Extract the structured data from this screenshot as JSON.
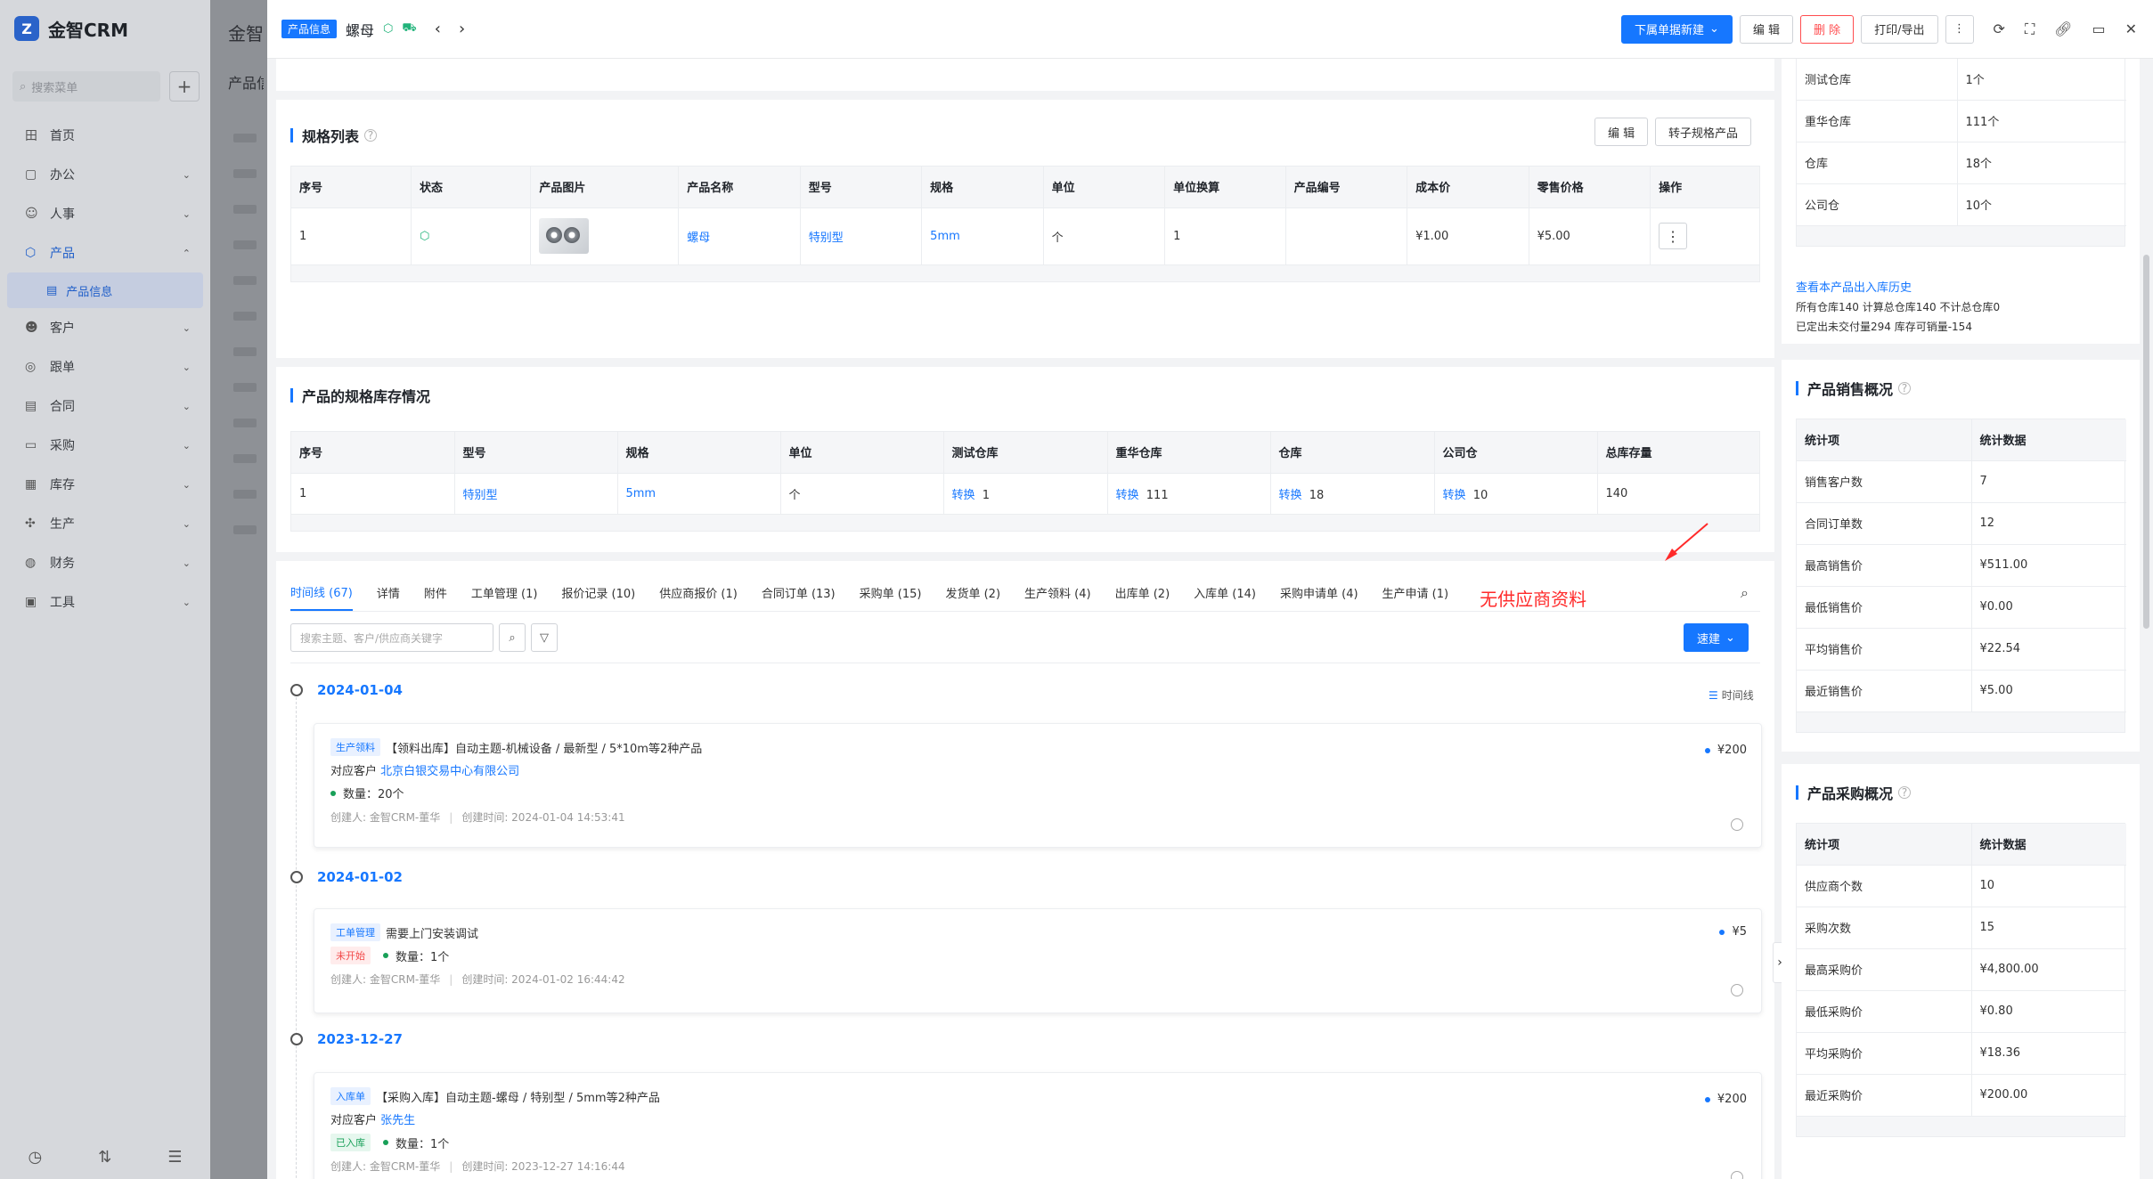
{
  "sidebar": {
    "logo_mark": "Z",
    "brand": "金智CRM",
    "search_placeholder": "搜索菜单",
    "items": [
      {
        "icon": "田",
        "label": "首页"
      },
      {
        "icon": "▢",
        "label": "办公"
      },
      {
        "icon": "☺",
        "label": "人事"
      },
      {
        "icon": "⬡",
        "label": "产品"
      },
      {
        "icon": "☻",
        "label": "客户"
      },
      {
        "icon": "◎",
        "label": "跟单"
      },
      {
        "icon": "▤",
        "label": "合同"
      },
      {
        "icon": "▭",
        "label": "采购"
      },
      {
        "icon": "▦",
        "label": "库存"
      },
      {
        "icon": "✣",
        "label": "生产"
      },
      {
        "icon": "◍",
        "label": "财务"
      },
      {
        "icon": "▣",
        "label": "工具"
      }
    ],
    "sub_item": "产品信息"
  },
  "background_page": {
    "title": "金智银",
    "subtitle": "产品信"
  },
  "header": {
    "tag": "产品信息",
    "title": "螺母",
    "primary_button": "下属单据新建",
    "edit_button": "编 辑",
    "delete_button": "删 除",
    "print_button": "打印/导出"
  },
  "spec_list": {
    "title": "规格列表",
    "edit_button": "编 辑",
    "convert_button": "转子规格产品",
    "columns": [
      "序号",
      "状态",
      "产品图片",
      "产品名称",
      "型号",
      "规格",
      "单位",
      "单位换算",
      "产品编号",
      "成本价",
      "零售价格",
      "操作"
    ],
    "row": {
      "no": "1",
      "name": "螺母",
      "model": "特别型",
      "spec": "5mm",
      "unit": "个",
      "conv": "1",
      "code": "",
      "cost": "¥1.00",
      "retail": "¥5.00"
    }
  },
  "spec_stock": {
    "title": "产品的规格库存情况",
    "columns": [
      "序号",
      "型号",
      "规格",
      "单位",
      "测试仓库",
      "重华仓库",
      "仓库",
      "公司仓",
      "总库存量"
    ],
    "link": "转换",
    "row": {
      "no": "1",
      "model": "特别型",
      "spec": "5mm",
      "unit": "个",
      "w1": "1",
      "w2": "111",
      "w3": "18",
      "w4": "10",
      "total": "140"
    }
  },
  "tabs": {
    "items": [
      "时间线 (67)",
      "详情",
      "附件",
      "工单管理 (1)",
      "报价记录 (10)",
      "供应商报价 (1)",
      "合同订单 (13)",
      "采购单 (15)",
      "发货单 (2)",
      "生产领料 (4)",
      "出库单 (2)",
      "入库单 (14)",
      "采购申请单 (4)",
      "生产申请 (1)"
    ],
    "annotation": "无供应商资料"
  },
  "timeline": {
    "search_placeholder": "搜索主题、客户/供应商关键字",
    "quick_button": "速建",
    "view_label": "时间线",
    "groups": [
      {
        "date": "2024-01-04",
        "tag": "生产领料",
        "title": "【领料出库】自动主题-机械设备 / 最新型 / 5*10m等2种产品",
        "customer_label": "对应客户",
        "customer": "北京白银交易中心有限公司",
        "status": "",
        "qty": "数量：20个",
        "amount": "¥200",
        "creator": "创建人: 金智CRM-董华",
        "created": "创建时间: 2024-01-04 14:53:41"
      },
      {
        "date": "2024-01-02",
        "tag": "工单管理",
        "title": "需要上门安装调试",
        "customer_label": "",
        "customer": "",
        "status": "未开始",
        "qty": "数量：1个",
        "amount": "¥5",
        "creator": "创建人: 金智CRM-董华",
        "created": "创建时间: 2024-01-02 16:44:42"
      },
      {
        "date": "2023-12-27",
        "tag": "入库单",
        "title": "【采购入库】自动主题-螺母 / 特别型 / 5mm等2种产品",
        "customer_label": "对应客户",
        "customer": "张先生",
        "status": "已入库",
        "qty": "数量：1个",
        "amount": "¥200",
        "creator": "创建人: 金智CRM-董华",
        "created": "创建时间: 2023-12-27 14:16:44"
      }
    ]
  },
  "warehouse_panel": {
    "rows": [
      [
        "测试仓库",
        "1个"
      ],
      [
        "重华仓库",
        "111个"
      ],
      [
        "仓库",
        "18个"
      ],
      [
        "公司仓",
        "10个"
      ]
    ],
    "history_link": "查看本产品出入库历史",
    "note1": "所有仓库140 计算总仓库140 不计总仓库0",
    "note2": "已定出未交付量294 库存可销量-154"
  },
  "sales_panel": {
    "title": "产品销售概况",
    "head": [
      "统计项",
      "统计数据"
    ],
    "rows": [
      [
        "销售客户数",
        "7"
      ],
      [
        "合同订单数",
        "12"
      ],
      [
        "最高销售价",
        "¥511.00"
      ],
      [
        "最低销售价",
        "¥0.00"
      ],
      [
        "平均销售价",
        "¥22.54"
      ],
      [
        "最近销售价",
        "¥5.00"
      ]
    ]
  },
  "purchase_panel": {
    "title": "产品采购概况",
    "head": [
      "统计项",
      "统计数据"
    ],
    "rows": [
      [
        "供应商个数",
        "10"
      ],
      [
        "采购次数",
        "15"
      ],
      [
        "最高采购价",
        "¥4,800.00"
      ],
      [
        "最低采购价",
        "¥0.80"
      ],
      [
        "平均采购价",
        "¥18.36"
      ],
      [
        "最近采购价",
        "¥200.00"
      ]
    ]
  }
}
